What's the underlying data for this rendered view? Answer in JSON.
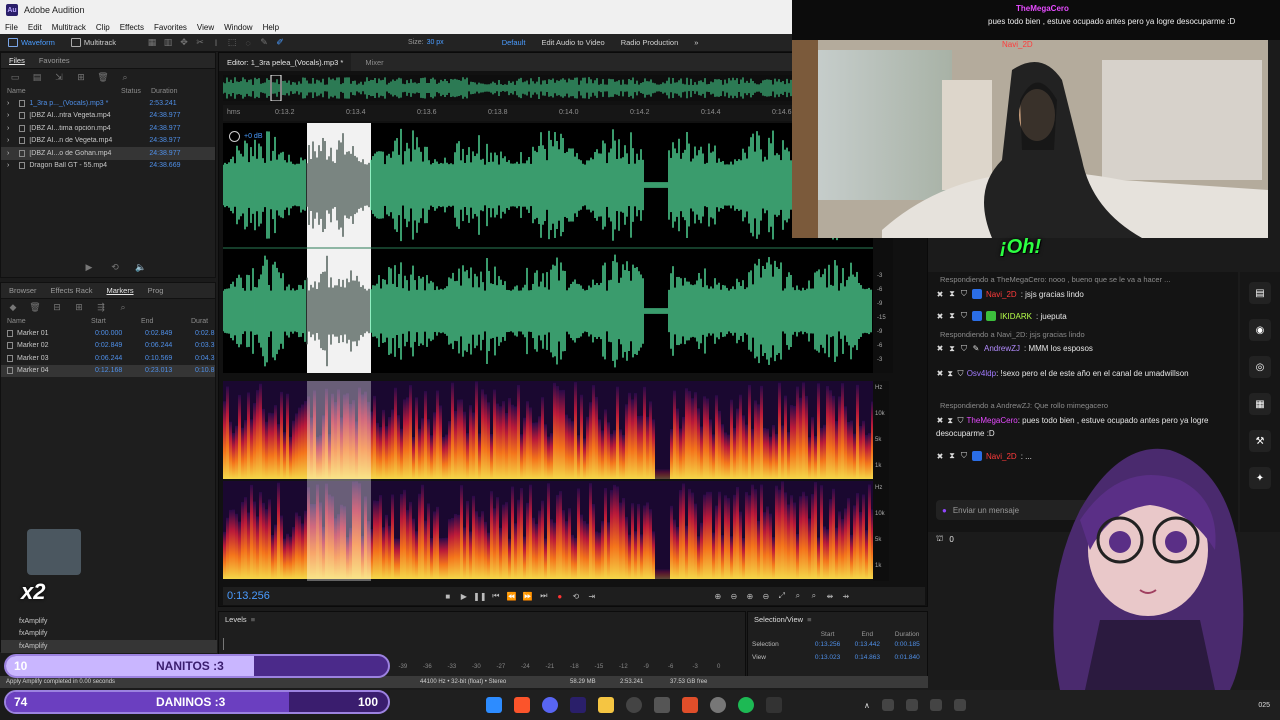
{
  "app": {
    "title": "Adobe Audition",
    "logo": "Au"
  },
  "menu": [
    "File",
    "Edit",
    "Multitrack",
    "Clip",
    "Effects",
    "Favorites",
    "View",
    "Window",
    "Help"
  ],
  "toolbar": {
    "waveform": "Waveform",
    "multitrack": "Multitrack",
    "size_label": "Size:",
    "size_value": "30 px",
    "default": "Default",
    "edit_av": "Edit Audio to Video",
    "radio": "Radio Production"
  },
  "files_panel": {
    "tabs": [
      "Files",
      "Favorites"
    ],
    "columns": [
      "Name",
      "Status",
      "Duration"
    ],
    "items": [
      {
        "name": "1_3ra p..._(Vocals).mp3 *",
        "duration": "2:53.241"
      },
      {
        "name": "[DBZ AI...ntra Vegeta.mp4",
        "duration": "24:38.977"
      },
      {
        "name": "[DBZ AI...tima opción.mp4",
        "duration": "24:38.977"
      },
      {
        "name": "[DBZ AI...n de Vegeta.mp4",
        "duration": "24:38.977"
      },
      {
        "name": "[DBZ AI...o de Gohan.mp4",
        "duration": "24:38.977"
      },
      {
        "name": "Dragon Ball GT - 55.mp4",
        "duration": "24:38.669"
      }
    ]
  },
  "markers_panel": {
    "tabs": [
      "Browser",
      "Effects Rack",
      "Markers",
      "Prog"
    ],
    "columns": [
      "Name",
      "Start",
      "End",
      "Durat"
    ],
    "items": [
      {
        "name": "Marker 01",
        "start": "0:00.000",
        "end": "0:02.849",
        "dur": "0:02.8"
      },
      {
        "name": "Marker 02",
        "start": "0:02.849",
        "end": "0:06.244",
        "dur": "0:03.3"
      },
      {
        "name": "Marker 03",
        "start": "0:06.244",
        "end": "0:10.569",
        "dur": "0:04.3"
      },
      {
        "name": "Marker 04",
        "start": "0:12.168",
        "end": "0:23.013",
        "dur": "0:10.8"
      }
    ]
  },
  "history": [
    "Amplify",
    "Amplify",
    "Amplify"
  ],
  "editor": {
    "tab": "Editor: 1_3ra pelea_(Vocals).mp3 *",
    "mixer": "Mixer",
    "ruler_unit": "hms",
    "ruler_ticks": [
      "0:13.2",
      "0:13.4",
      "0:13.6",
      "0:13.8",
      "0:14.0",
      "0:14.2",
      "0:14.4",
      "0:14.6"
    ],
    "gain": "+0 dB",
    "hz_labels": [
      "Hz",
      "10k",
      "5k",
      "1k",
      "Hz",
      "10k",
      "5k",
      "1k"
    ],
    "db_labels": [
      "-3",
      "-6",
      "-9",
      "-15",
      "-9",
      "-6",
      "-3"
    ],
    "timecode": "0:13.256"
  },
  "levels": {
    "title": "Levels",
    "scale": [
      "dB",
      "-57",
      "-54",
      "-51",
      "-48",
      "-45",
      "-42",
      "-39",
      "-36",
      "-33",
      "-30",
      "-27",
      "-24",
      "-21",
      "-18",
      "-15",
      "-12",
      "-9",
      "-6",
      "-3",
      "0"
    ]
  },
  "selection_view": {
    "title": "Selection/View",
    "cols": [
      "Start",
      "End",
      "Duration"
    ],
    "rows": [
      {
        "label": "Selection",
        "start": "0:13.256",
        "end": "0:13.442",
        "dur": "0:00.185"
      },
      {
        "label": "View",
        "start": "0:13.023",
        "end": "0:14.863",
        "dur": "0:01.840"
      }
    ]
  },
  "status": {
    "msg": "Apply Amplify completed in 0.00 seconds",
    "format": "44100 Hz • 32-bit (float) • Stereo",
    "size": "58.29 MB",
    "duration": "2:53.241",
    "free": "37.53 GB free"
  },
  "chat": {
    "top_user": "TheMegaCero",
    "top_message": "pues todo bien , estuve ocupado antes pero ya logre desocuparme :D",
    "top_user2": "Navi_2D",
    "caption": "¡Oh!",
    "messages": [
      {
        "reply": "Respondiendo a TheMegaCero: nooo , bueno que se le va a hacer ...",
        "user": "Navi_2D",
        "text": ": jsjs gracias lindo",
        "color": "#ff3b3b"
      },
      {
        "user": "IKIDARK",
        "text": ": jueputa",
        "color": "#b7ff4a"
      },
      {
        "reply": "Respondiendo a Navi_2D: jsjs gracias lindo",
        "user": "AndrewZJ",
        "text": ": MMM los esposos",
        "color": "#b38cff"
      },
      {
        "user": "Osv4ldp",
        "text": ": !sexo pero el de este año en el canal de umadwillson",
        "color": "#a27bff"
      },
      {
        "reply": "Respondiendo a AndrewZJ: Que rollo mimegacero",
        "user": "TheMegaCero",
        "text": ": pues todo bien , estuve ocupado antes pero ya logre desocuparme :D",
        "color": "#e64bff"
      },
      {
        "user": "Navi_2D",
        "text": ": ...",
        "color": "#ff3b3b"
      }
    ],
    "input_placeholder": "Enviar un mensaje",
    "points": "0"
  },
  "overlay": {
    "bar1_left": "10",
    "bar1_text": "NANITOS :3",
    "bar1_level": 0.65,
    "bar2_left": "74",
    "bar2_text": "DANINOS :3",
    "bar2_right": "100",
    "bar2_level": 0.74,
    "multiplier": "x2"
  },
  "clock": {
    "line1": "",
    "line2": "025"
  },
  "colors": {
    "accent": "#4a9cff",
    "wave": "#4dffa6",
    "brand": "#9146ff"
  }
}
